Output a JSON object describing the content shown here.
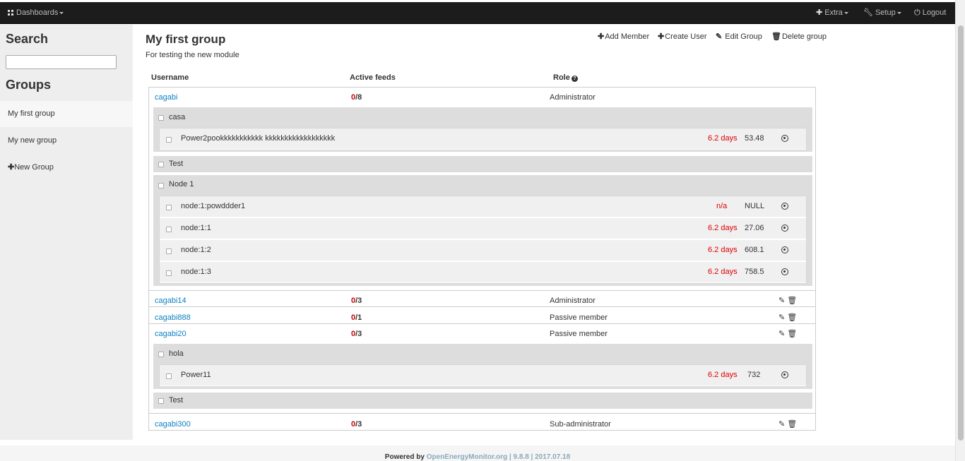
{
  "topbar": {
    "dashboards": "Dashboards",
    "extra": "Extra",
    "setup": "Setup",
    "logout": "Logout"
  },
  "sidebar": {
    "search_title": "Search",
    "groups_title": "Groups",
    "groups": [
      "My first group",
      "My new group"
    ],
    "new_group": "New Group"
  },
  "main": {
    "title": "My first group",
    "description": "For testing the new module",
    "actions": {
      "add_member": "Add Member",
      "create_user": "Create User",
      "edit_group": "Edit Group",
      "delete_group": "Delete group"
    },
    "columns": {
      "username": "Username",
      "active_feeds": "Active feeds",
      "role": "Role"
    }
  },
  "members": [
    {
      "username": "cagabi",
      "active": "0",
      "total": "/8",
      "role": "Administrator",
      "nodes": [
        {
          "name": "casa",
          "feeds": [
            {
              "name": "Power2pookkkkkkkkkkk kkkkkkkkkkkkkkkkkk",
              "time": "6.2 days",
              "value": "53.48"
            }
          ]
        },
        {
          "name": "Test",
          "feeds": []
        },
        {
          "name": "Node 1",
          "feeds": [
            {
              "name": "node:1:powddder1",
              "time": "n/a",
              "value": "NULL"
            },
            {
              "name": "node:1:1",
              "time": "6.2 days",
              "value": "27.06"
            },
            {
              "name": "node:1:2",
              "time": "6.2 days",
              "value": "608.1"
            },
            {
              "name": "node:1:3",
              "time": "6.2 days",
              "value": "758.5"
            }
          ]
        }
      ]
    },
    {
      "username": "cagabi14",
      "active": "0",
      "total": "/3",
      "role": "Administrator"
    },
    {
      "username": "cagabi888",
      "active": "0",
      "total": "/1",
      "role": "Passive member"
    },
    {
      "username": "cagabi20",
      "active": "0",
      "total": "/3",
      "role": "Passive member",
      "nodes": [
        {
          "name": "hola",
          "feeds": [
            {
              "name": "Power11",
              "time": "6.2 days",
              "value": "732"
            }
          ]
        },
        {
          "name": "Test",
          "feeds": []
        }
      ]
    },
    {
      "username": "cagabi300",
      "active": "0",
      "total": "/3",
      "role": "Sub-administrator"
    }
  ],
  "footer": {
    "powered_by": "Powered by",
    "site": "OpenEnergyMonitor.org",
    "version": "| 9.8.8 | 2017.07.18"
  },
  "colors": {
    "link": "#0a7fc2",
    "stale": "#dd0000",
    "topbar": "#1c1c1c",
    "sidebar": "#eeeeee"
  }
}
